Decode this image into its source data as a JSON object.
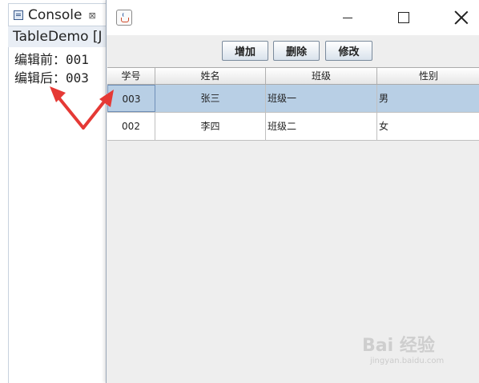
{
  "console": {
    "tab_label": "Console",
    "close_glyph": "⊠",
    "header_text": "TableDemo [J",
    "lines": [
      "编辑前：001",
      "编辑后：003"
    ]
  },
  "window": {
    "toolbar": {
      "add_label": "增加",
      "delete_label": "删除",
      "edit_label": "修改"
    },
    "table": {
      "columns": [
        "学号",
        "姓名",
        "班级",
        "性别"
      ],
      "rows": [
        [
          "003",
          "张三",
          "班级一",
          "男"
        ],
        [
          "002",
          "李四",
          "班级二",
          "女"
        ]
      ],
      "selected_row": 0
    }
  },
  "watermark": {
    "text": "Bai 经验",
    "sub": "jingyan.baidu.com"
  },
  "colors": {
    "selection": "#b8cfe5",
    "arrow": "#e53935",
    "window_bg": "#eeeeee"
  },
  "icons": [
    "console-icon",
    "java-cup-icon",
    "minimize-icon",
    "maximize-icon",
    "close-icon",
    "red-arrow-icon"
  ]
}
